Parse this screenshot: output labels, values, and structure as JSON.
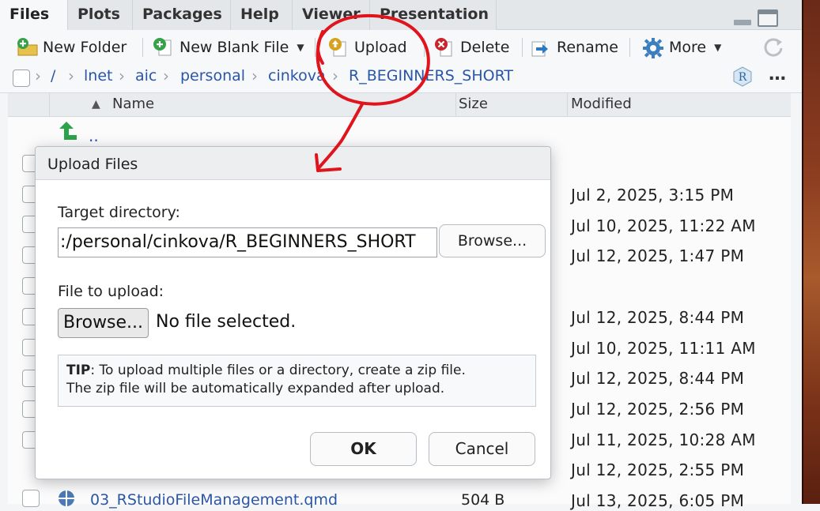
{
  "tabs": [
    "Files",
    "Plots",
    "Packages",
    "Help",
    "Viewer",
    "Presentation"
  ],
  "toolbar": {
    "new_folder": "New Folder",
    "new_blank_file": "New Blank File",
    "upload": "Upload",
    "delete": "Delete",
    "rename": "Rename",
    "more": "More"
  },
  "breadcrumb": [
    "/",
    "lnet",
    "aic",
    "personal",
    "cinkova",
    "R_BEGINNERS_SHORT"
  ],
  "columns": {
    "name": "Name",
    "size": "Size",
    "modified": "Modified"
  },
  "parent_dir_label": "..",
  "files": [
    {
      "modified": "Jul 2, 2025, 3:15 PM"
    },
    {
      "modified": "Jul 10, 2025, 11:22 AM"
    },
    {
      "modified": "Jul 12, 2025, 1:47 PM"
    },
    {
      "modified": ""
    },
    {
      "modified": "Jul 12, 2025, 8:44 PM"
    },
    {
      "modified": "Jul 10, 2025, 11:11 AM"
    },
    {
      "modified": "Jul 12, 2025, 8:44 PM"
    },
    {
      "modified": "Jul 12, 2025, 2:56 PM"
    },
    {
      "modified": "Jul 11, 2025, 10:28 AM"
    },
    {
      "modified": "Jul 12, 2025, 2:55 PM"
    },
    {
      "name": "03_RStudioFileManagement.qmd",
      "size": "504 B",
      "modified": "Jul 13, 2025, 6:05 PM"
    }
  ],
  "dialog": {
    "title": "Upload Files",
    "target_label": "Target directory:",
    "target_value": ":/personal/cinkova/R_BEGINNERS_SHORT",
    "browse_dir": "Browse...",
    "file_label": "File to upload:",
    "browse_file": "Browse...",
    "no_file": "No file selected.",
    "tip_strong": "TIP",
    "tip_text": ": To upload multiple files or a directory, create a zip file.",
    "tip_text2": "The zip file will be automatically expanded after upload.",
    "ok": "OK",
    "cancel": "Cancel"
  },
  "colors": {
    "link": "#2a56a8",
    "annotation": "#e0141c"
  }
}
